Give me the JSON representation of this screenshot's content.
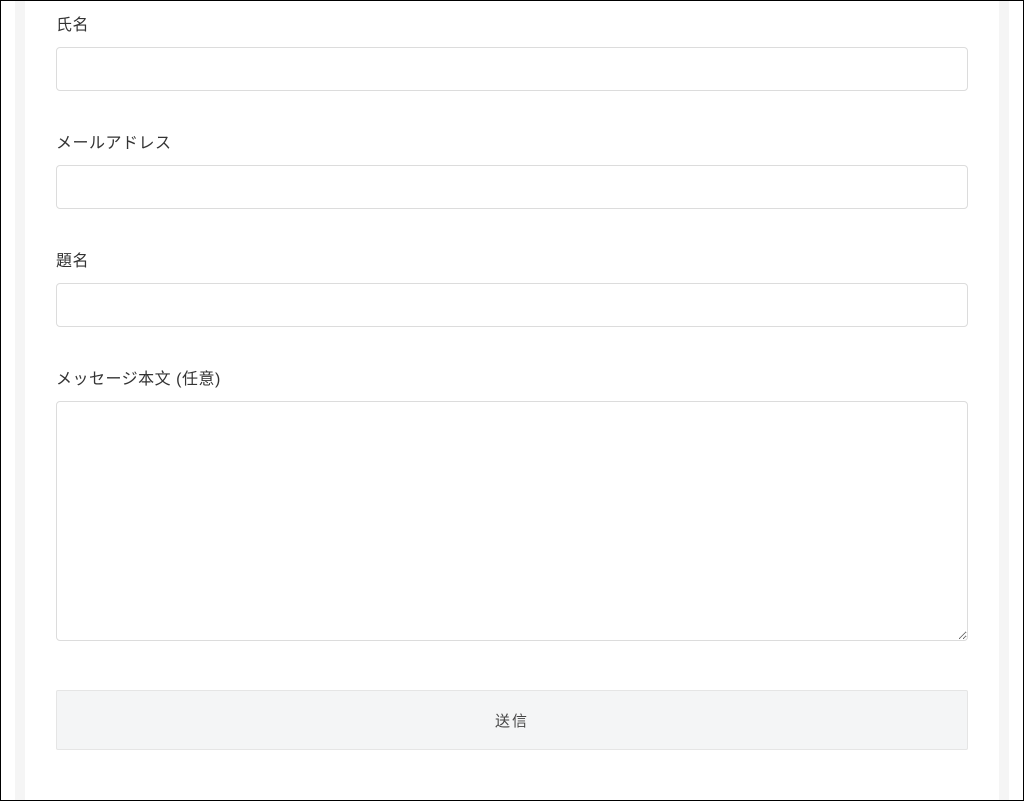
{
  "form": {
    "fields": {
      "name": {
        "label": "氏名",
        "value": ""
      },
      "email": {
        "label": "メールアドレス",
        "value": ""
      },
      "subject": {
        "label": "題名",
        "value": ""
      },
      "message": {
        "label": "メッセージ本文 (任意)",
        "value": ""
      }
    },
    "submit_label": "送信"
  }
}
